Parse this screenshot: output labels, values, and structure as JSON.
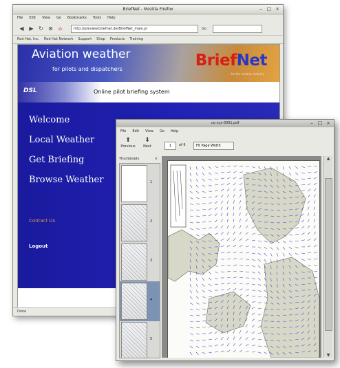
{
  "browser": {
    "title": "BriefNet - Mozilla Firefox",
    "menu": [
      "File",
      "Edit",
      "View",
      "Go",
      "Bookmarks",
      "Tools",
      "Help"
    ],
    "url": "http://preview.briefnet.de/BriefNet_main.pl",
    "go_label": "Go",
    "bookmarks": [
      "Red Hat, Inc.",
      "Red Hat Network",
      "Support",
      "Shop",
      "Products",
      "Training"
    ],
    "status": "Done"
  },
  "site": {
    "banner_title": "Aviation weather",
    "banner_subtitle": "for pilots and dispatchers",
    "brand_part1": "Brief",
    "brand_part2": "Net",
    "brand_tagline": "for the aviation industry",
    "logo": "DSL",
    "subheader": "Online pilot briefing system",
    "nav": [
      "Welcome",
      "Local Weather",
      "Get Briefing",
      "Browse Weather"
    ],
    "contact": "Contact Us",
    "logout": "Logout",
    "colors": {
      "nav_bg": "#2121b4",
      "brand_red": "#d62011",
      "brand_blue": "#2a37c6",
      "contact": "#d59a4a"
    }
  },
  "viewer": {
    "title": "cu-xyz-0001.pdf",
    "menu": [
      "File",
      "Edit",
      "View",
      "Go",
      "Help"
    ],
    "toolbar": {
      "previous_label": "Previous",
      "next_label": "Next",
      "page_value": "1",
      "of_label": "of 6",
      "zoom_value": "Fit Page Width"
    },
    "thumbnails_label": "Thumbnails",
    "thumb_numbers": [
      "1",
      "2",
      "3",
      "4",
      "5"
    ],
    "selected_thumb": 4
  }
}
